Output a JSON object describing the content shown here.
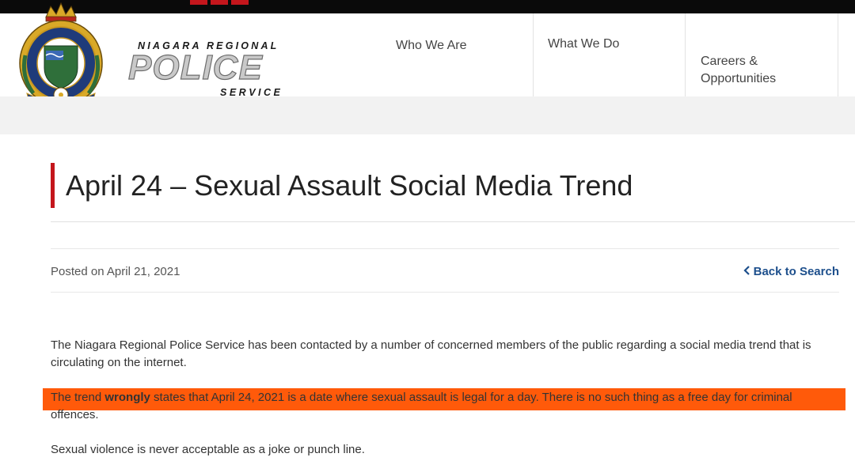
{
  "header": {
    "logo": {
      "top_line": "NIAGARA REGIONAL",
      "main": "POLICE",
      "bottom_line": "SERVICE"
    },
    "nav": [
      {
        "label": "Who We Are"
      },
      {
        "label": "What We Do"
      },
      {
        "label": "Careers &\nOpportunities"
      }
    ]
  },
  "article": {
    "title": "April 24 – Sexual Assault Social Media Trend",
    "posted": "Posted on April 21, 2021",
    "back_label": "Back to Search",
    "paragraph1": "The Niagara Regional Police Service has been contacted by a number of concerned members of the public regarding a social media trend that is circulating on the internet.",
    "paragraph2_before": "The trend ",
    "paragraph2_bold": "wrongly",
    "paragraph2_after": " states that April 24, 2021 is a date where sexual assault is legal for a day. There is no such thing as a free day for criminal offences.",
    "paragraph3": "Sexual violence is never acceptable as a joke or punch line."
  },
  "colors": {
    "accent_red": "#c4161c",
    "link_blue": "#1d4f8c",
    "highlight_orange": "#ff5a0a"
  },
  "icons": {
    "crest": "police-crest-icon",
    "back": "chevron-left-icon"
  }
}
